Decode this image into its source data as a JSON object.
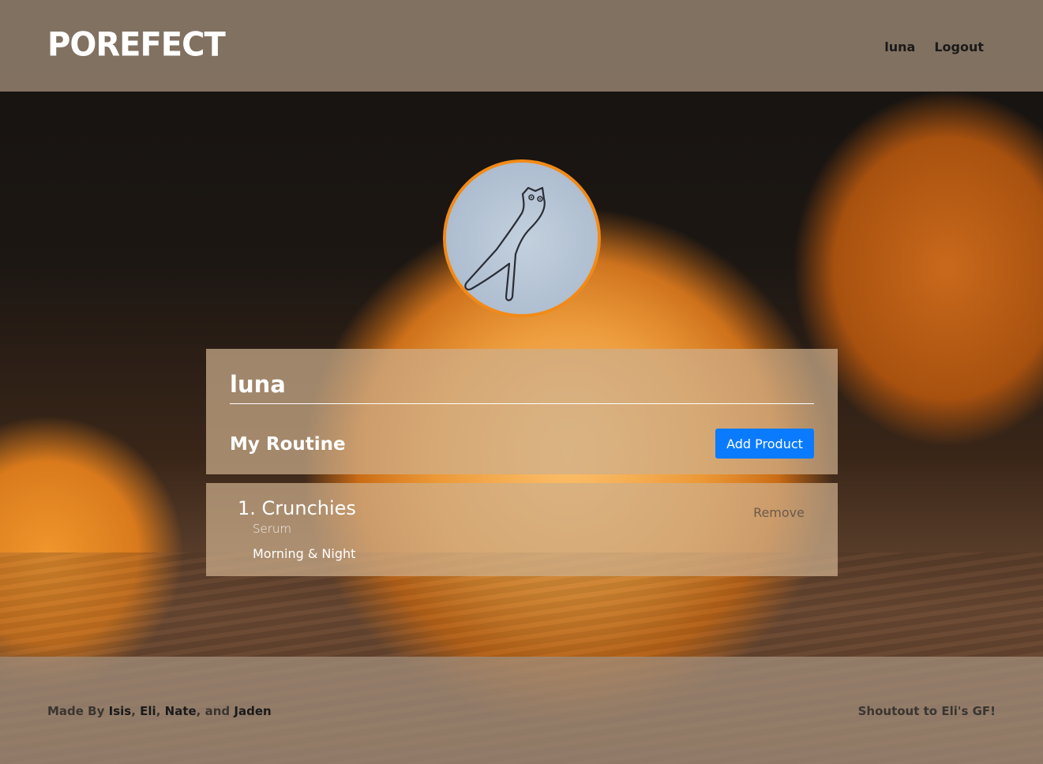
{
  "header": {
    "logo": "POREFECT",
    "nav": {
      "user": "luna",
      "logout": "Logout"
    }
  },
  "profile": {
    "username": "luna",
    "routine_title": "My Routine",
    "add_product_label": "Add Product"
  },
  "routine": [
    {
      "number": "1.",
      "name": "Crunchies",
      "type": "Serum",
      "time": "Morning & Night",
      "remove_label": "Remove"
    }
  ],
  "footer": {
    "made_by_prefix": "Made By",
    "authors": [
      "Isis",
      "Eli",
      "Nate",
      "Jaden"
    ],
    "sep1": ",",
    "sep2": ",",
    "sep3": ", and",
    "shoutout": "Shoutout to Eli's GF!"
  },
  "colors": {
    "accent": "#0a7bff",
    "avatar_border": "#f28a17"
  }
}
